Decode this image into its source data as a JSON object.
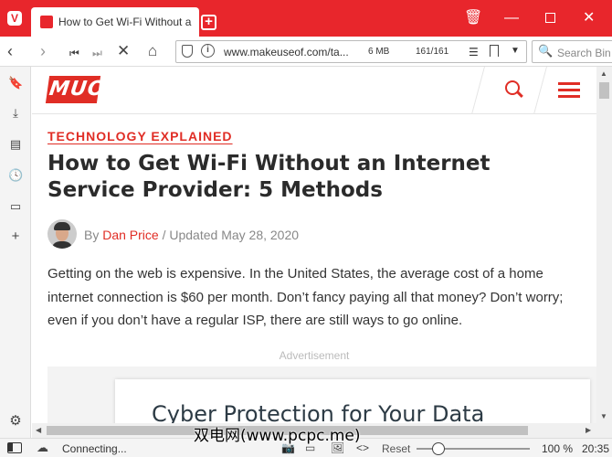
{
  "browser": {
    "tab_title": "How to Get Wi-Fi Without a",
    "url": "www.makeuseof.com/ta...",
    "page_size": "6 MB",
    "resource_count": "161/161",
    "search_placeholder": "Search Bin",
    "accent": "#e8262c"
  },
  "site": {
    "logo_text": "MUO",
    "brand_color": "#e02d25"
  },
  "article": {
    "category": "TECHNOLOGY EXPLAINED",
    "title": "How to Get Wi-Fi Without an Internet Service Provider: 5 Methods",
    "byline_prefix": "By",
    "author": "Dan Price",
    "byline_separator": "/",
    "updated": "Updated May 28, 2020",
    "body": "Getting on the web is expensive. In the United States, the average cost of a home internet connection is $60 per month. Don’t fancy paying all that money? Don’t worry; even if you don’t have a regular ISP, there are still ways to go online."
  },
  "ad": {
    "label": "Advertisement",
    "headline": "Cyber Protection for Your Data"
  },
  "statusbar": {
    "status": "Connecting...",
    "reset_label": "Reset",
    "zoom": "100 %",
    "clock": "20:35",
    "zoom_value": 100
  },
  "watermark": "双电网(www.pcpc.me)"
}
